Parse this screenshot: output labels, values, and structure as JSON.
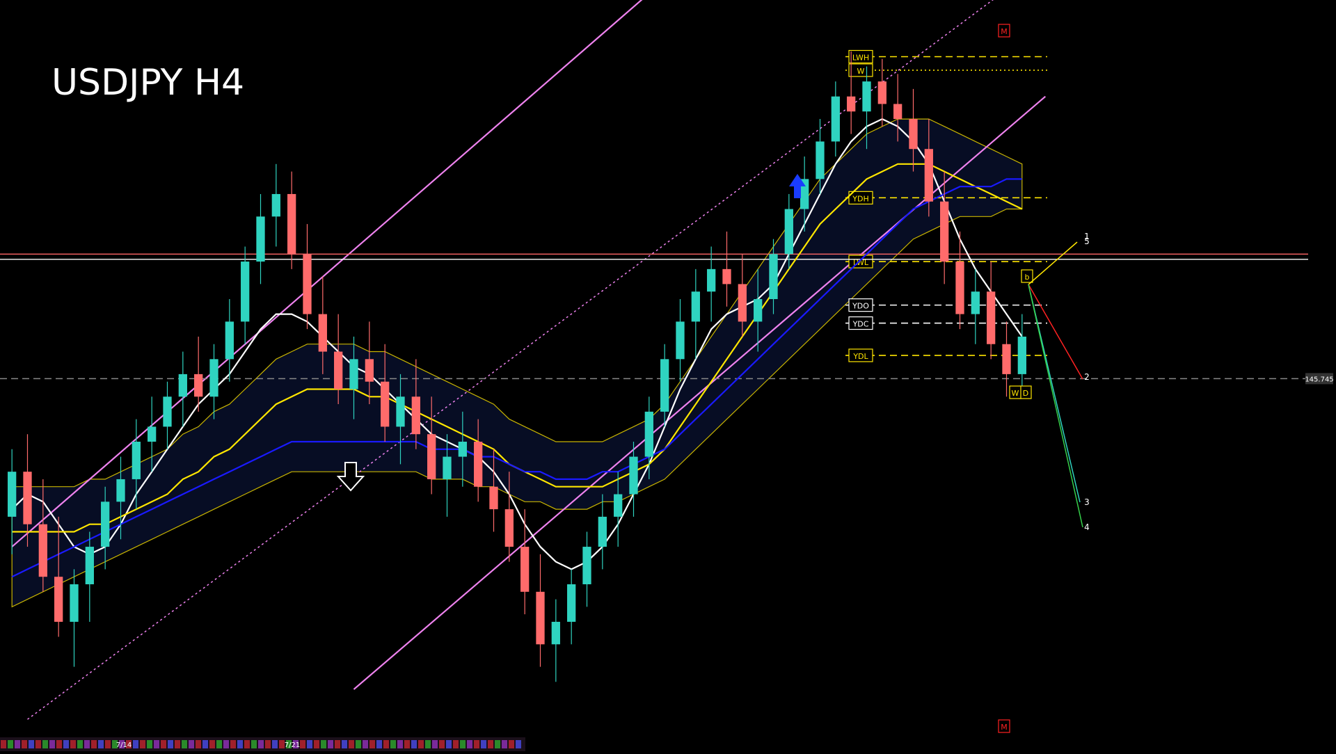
{
  "chart_data": {
    "type": "candlestick",
    "title": "USDJPY H4",
    "x_tick_labels": [
      "7/14",
      "7/21"
    ],
    "price_scale_label": "145.745",
    "y_domain": [
      142.5,
      152.0
    ],
    "candles": [
      [
        145.3,
        146.2,
        144.8,
        145.9
      ],
      [
        145.9,
        146.4,
        144.9,
        145.2
      ],
      [
        145.2,
        145.8,
        144.3,
        144.5
      ],
      [
        144.5,
        145.3,
        143.7,
        143.9
      ],
      [
        143.9,
        144.6,
        143.3,
        144.4
      ],
      [
        144.4,
        145.1,
        143.9,
        144.9
      ],
      [
        144.9,
        145.7,
        144.6,
        145.5
      ],
      [
        145.5,
        146.1,
        145.0,
        145.8
      ],
      [
        145.8,
        146.6,
        145.4,
        146.3
      ],
      [
        146.3,
        146.9,
        145.9,
        146.5
      ],
      [
        146.5,
        147.1,
        146.2,
        146.9
      ],
      [
        146.9,
        147.5,
        146.5,
        147.2
      ],
      [
        147.2,
        147.7,
        146.7,
        146.9
      ],
      [
        146.9,
        147.6,
        146.6,
        147.4
      ],
      [
        147.4,
        148.2,
        147.1,
        147.9
      ],
      [
        147.9,
        148.9,
        147.6,
        148.7
      ],
      [
        148.7,
        149.6,
        148.4,
        149.3
      ],
      [
        149.3,
        150.0,
        148.9,
        149.6
      ],
      [
        149.6,
        149.9,
        148.6,
        148.8
      ],
      [
        148.8,
        149.2,
        147.8,
        148.0
      ],
      [
        148.0,
        148.5,
        147.2,
        147.5
      ],
      [
        147.5,
        148.0,
        146.8,
        147.0
      ],
      [
        147.0,
        147.7,
        146.6,
        147.4
      ],
      [
        147.4,
        147.9,
        146.8,
        147.1
      ],
      [
        147.1,
        147.6,
        146.3,
        146.5
      ],
      [
        146.5,
        147.2,
        146.0,
        146.9
      ],
      [
        146.9,
        147.4,
        146.2,
        146.4
      ],
      [
        146.4,
        146.9,
        145.6,
        145.8
      ],
      [
        145.8,
        146.4,
        145.3,
        146.1
      ],
      [
        146.1,
        146.7,
        145.7,
        146.3
      ],
      [
        146.3,
        146.6,
        145.5,
        145.7
      ],
      [
        145.7,
        146.2,
        145.1,
        145.4
      ],
      [
        145.4,
        145.9,
        144.7,
        144.9
      ],
      [
        144.9,
        145.4,
        144.0,
        144.3
      ],
      [
        144.3,
        144.8,
        143.3,
        143.6
      ],
      [
        143.6,
        144.2,
        143.1,
        143.9
      ],
      [
        143.9,
        144.6,
        143.6,
        144.4
      ],
      [
        144.4,
        145.1,
        144.1,
        144.9
      ],
      [
        144.9,
        145.6,
        144.6,
        145.3
      ],
      [
        145.3,
        145.9,
        144.9,
        145.6
      ],
      [
        145.6,
        146.3,
        145.3,
        146.1
      ],
      [
        146.1,
        146.9,
        145.8,
        146.7
      ],
      [
        146.7,
        147.6,
        146.5,
        147.4
      ],
      [
        147.4,
        148.2,
        147.1,
        147.9
      ],
      [
        147.9,
        148.6,
        147.4,
        148.3
      ],
      [
        148.3,
        148.9,
        147.9,
        148.6
      ],
      [
        148.6,
        149.1,
        148.1,
        148.4
      ],
      [
        148.4,
        148.8,
        147.7,
        147.9
      ],
      [
        147.9,
        148.6,
        147.5,
        148.2
      ],
      [
        148.2,
        149.0,
        148.0,
        148.8
      ],
      [
        148.8,
        149.6,
        148.6,
        149.4
      ],
      [
        149.4,
        150.1,
        149.1,
        149.8
      ],
      [
        149.8,
        150.6,
        149.6,
        150.3
      ],
      [
        150.3,
        151.1,
        150.1,
        150.9
      ],
      [
        150.9,
        151.5,
        150.4,
        150.7
      ],
      [
        150.7,
        151.3,
        150.2,
        151.1
      ],
      [
        151.1,
        151.4,
        150.5,
        150.8
      ],
      [
        150.8,
        151.2,
        150.3,
        150.6
      ],
      [
        150.6,
        151.0,
        149.9,
        150.2
      ],
      [
        150.2,
        150.6,
        149.3,
        149.5
      ],
      [
        149.5,
        149.9,
        148.4,
        148.7
      ],
      [
        148.7,
        149.1,
        147.8,
        148.0
      ],
      [
        148.0,
        148.6,
        147.6,
        148.3
      ],
      [
        148.3,
        148.7,
        147.4,
        147.6
      ],
      [
        147.6,
        147.9,
        146.9,
        147.2
      ],
      [
        147.2,
        148.0,
        146.9,
        147.7
      ]
    ],
    "overlay_lines": [
      {
        "name": "",
        "color": "#ffffff",
        "width": 2.2,
        "values": [
          145.4,
          145.6,
          145.5,
          145.2,
          144.9,
          144.8,
          144.9,
          145.2,
          145.6,
          145.9,
          146.2,
          146.5,
          146.8,
          147.0,
          147.2,
          147.5,
          147.8,
          148.0,
          148.0,
          147.9,
          147.7,
          147.5,
          147.3,
          147.2,
          147.0,
          146.8,
          146.6,
          146.4,
          146.3,
          146.2,
          146.1,
          145.9,
          145.6,
          145.2,
          144.9,
          144.7,
          144.6,
          144.7,
          144.9,
          145.2,
          145.6,
          146.0,
          146.5,
          147.0,
          147.4,
          147.8,
          148.0,
          148.1,
          148.2,
          148.4,
          148.8,
          149.2,
          149.6,
          150.0,
          150.3,
          150.5,
          150.6,
          150.5,
          150.3,
          150.0,
          149.5,
          149.0,
          148.6,
          148.3,
          148.0,
          147.7
        ]
      },
      {
        "name": "",
        "color": "#ffe600",
        "width": 2.2,
        "values": [
          145.1,
          145.1,
          145.1,
          145.1,
          145.1,
          145.2,
          145.2,
          145.3,
          145.4,
          145.5,
          145.6,
          145.8,
          145.9,
          146.1,
          146.2,
          146.4,
          146.6,
          146.8,
          146.9,
          147.0,
          147.0,
          147.0,
          147.0,
          146.9,
          146.9,
          146.8,
          146.7,
          146.6,
          146.5,
          146.4,
          146.3,
          146.2,
          146.0,
          145.9,
          145.8,
          145.7,
          145.7,
          145.7,
          145.7,
          145.8,
          145.9,
          146.0,
          146.2,
          146.5,
          146.8,
          147.1,
          147.4,
          147.7,
          148.0,
          148.3,
          148.6,
          148.9,
          149.2,
          149.4,
          149.6,
          149.8,
          149.9,
          150.0,
          150.0,
          150.0,
          149.9,
          149.8,
          149.7,
          149.6,
          149.5,
          149.4
        ]
      },
      {
        "name": "",
        "color": "#1a1aff",
        "width": 2.2,
        "values": [
          144.5,
          144.6,
          144.7,
          144.8,
          144.9,
          145.0,
          145.1,
          145.2,
          145.3,
          145.4,
          145.5,
          145.6,
          145.7,
          145.8,
          145.9,
          146.0,
          146.1,
          146.2,
          146.3,
          146.3,
          146.3,
          146.3,
          146.3,
          146.3,
          146.3,
          146.3,
          146.3,
          146.2,
          146.2,
          146.2,
          146.1,
          146.1,
          146.0,
          145.9,
          145.9,
          145.8,
          145.8,
          145.8,
          145.9,
          145.9,
          146.0,
          146.1,
          146.2,
          146.4,
          146.6,
          146.8,
          147.0,
          147.2,
          147.4,
          147.6,
          147.8,
          148.0,
          148.2,
          148.4,
          148.6,
          148.8,
          149.0,
          149.2,
          149.4,
          149.5,
          149.6,
          149.7,
          149.7,
          149.7,
          149.8,
          149.8
        ]
      }
    ],
    "channel_lines": [
      {
        "color": "#ee82ee",
        "dash": "",
        "from": [
          0,
          144.9
        ],
        "to": [
          41.7,
          152.4
        ]
      },
      {
        "color": "#ee82ee",
        "dash": "",
        "from": [
          22,
          143.0
        ],
        "to": [
          66.5,
          150.9
        ]
      },
      {
        "color": "#ee82ee",
        "dash": "3,4",
        "from": [
          1,
          142.6
        ],
        "to": [
          64.5,
          152.4
        ]
      }
    ],
    "horizontal_levels": [
      {
        "label": "LWH",
        "price": 151.43,
        "color": "#ffe600",
        "style": "dashed"
      },
      {
        "label": "W",
        "price": 151.25,
        "color": "#ffe600",
        "style": "dotted"
      },
      {
        "label": "YDH",
        "price": 149.55,
        "color": "#ffe600",
        "style": "dashed"
      },
      {
        "label": "LWL",
        "price": 148.7,
        "color": "#ffe600",
        "style": "dashed"
      },
      {
        "label": "YDO",
        "price": 148.12,
        "color": "#ffffff",
        "style": "dashed"
      },
      {
        "label": "YDC",
        "price": 147.88,
        "color": "#ffffff",
        "style": "dashed"
      },
      {
        "label": "YDL",
        "price": 147.45,
        "color": "#ffe600",
        "style": "dashed"
      },
      {
        "label": "",
        "price": 148.8,
        "color": "#ff6666",
        "style": "solid"
      },
      {
        "label": "",
        "price": 148.73,
        "color": "#ffffff",
        "style": "solid"
      },
      {
        "label": "",
        "price": 147.14,
        "color": "#888888",
        "style": "dashed"
      }
    ],
    "projection_labels": [
      "1",
      "5",
      "2",
      "3",
      "4"
    ],
    "pivot_markers": [
      "b",
      "D",
      "M",
      "M",
      "W"
    ]
  }
}
